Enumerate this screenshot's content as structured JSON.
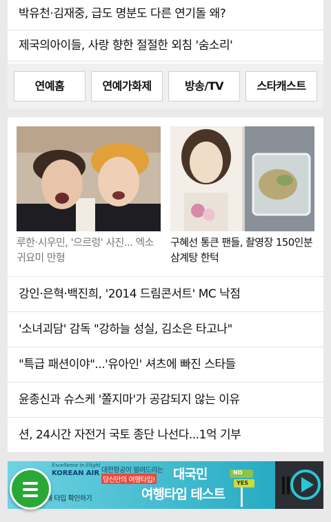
{
  "top_headlines": [
    "박유천·김재중, 급도 명분도 다른 연기돌 왜?",
    "제국의아이들, 사랑 향한 절절한 외침 '숨소리'"
  ],
  "tabs": [
    "연예홈",
    "연예가화제",
    "방송/TV",
    "스타캐스트"
  ],
  "photo_news": [
    {
      "caption": "루한·시우민, '으르렁' 사진... 엑소 귀요미 만형",
      "style": "dim"
    },
    {
      "caption": "구혜선 통큰 팬들, 촬영장 150인분 삼계탕 한턱",
      "style": "dark"
    }
  ],
  "news_list": [
    "강인·은혁·백진희, '2014 드림콘서트' MC 낙점",
    "'소녀괴담' 감독 \"강하늘 성실, 김소은 타고나\"",
    "\"특급 패션이야\"...'유아인' 셔츠에 빠진 스타들",
    "윤종신과 슈스케 '쫄지마'가 공감되지 않는 이유",
    "션, 24시간 자전거 국토 종단 나선다...1억 기부"
  ],
  "ad": {
    "tagline": "Excellence in Flight",
    "brand": "KOREAN AIR",
    "sub": "대한항공이 알려드리는",
    "sub2": "당신만의 여행타입!",
    "title1": "대국민",
    "title2": "여행타입 테스트",
    "cta": "내 타입 확인하기",
    "sign_no": "NO",
    "sign_yes": "YES"
  },
  "colors": {
    "background": "#e9e9e9",
    "menu_button": "#2aa836",
    "ad_bg": "#2bb5c9"
  }
}
